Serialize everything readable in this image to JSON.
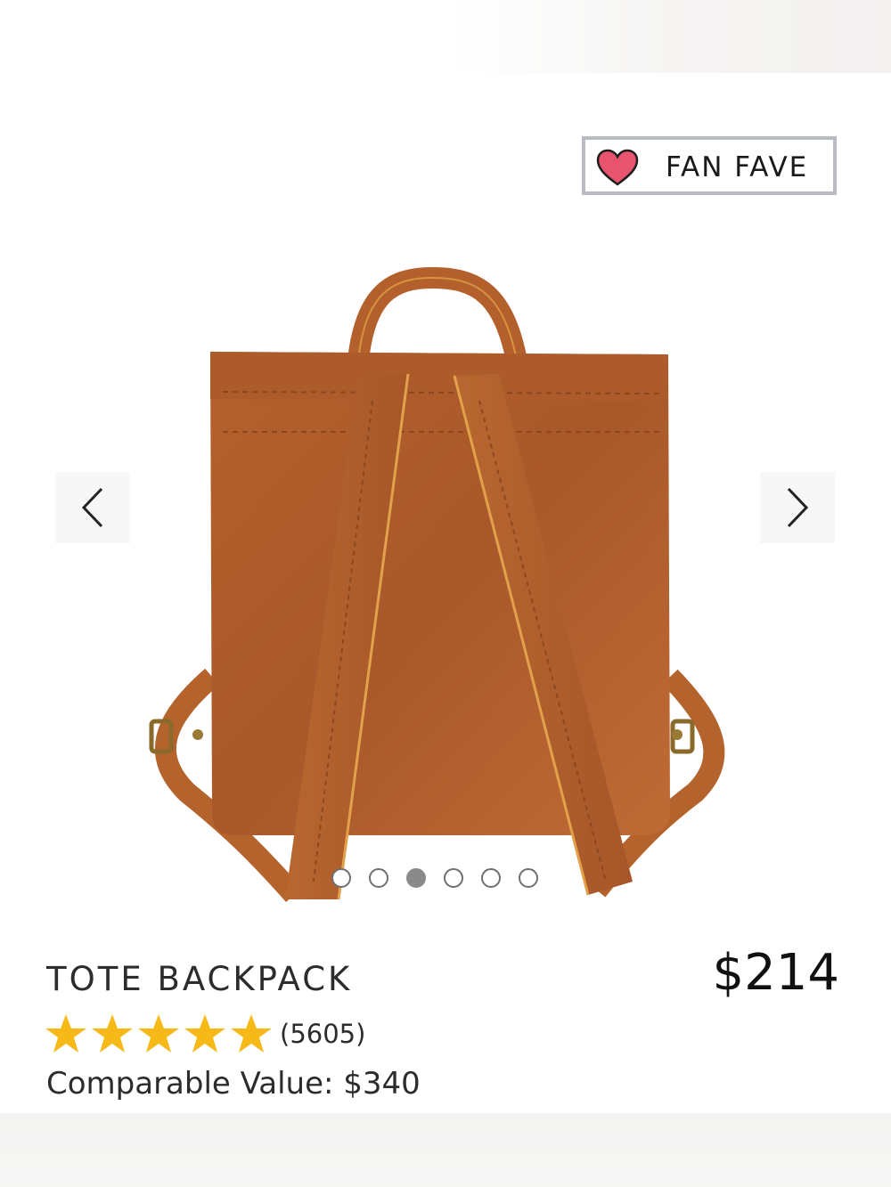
{
  "badge": {
    "label": "FAN FAVE",
    "icon": "heart-icon",
    "heart_color": "#e8536e"
  },
  "product": {
    "name": "TOTE BACKPACK",
    "price": "$214",
    "rating": {
      "stars": 5,
      "max_stars": 5,
      "count": "(5605)",
      "star_color": "#f7b917"
    },
    "comparable_label": "Comparable Value:",
    "comparable_value": "$340",
    "leather_color": "#b3612c"
  },
  "gallery": {
    "slide_count": 6,
    "active_index": 2,
    "prev_icon": "chevron-left-icon",
    "next_icon": "chevron-right-icon"
  }
}
